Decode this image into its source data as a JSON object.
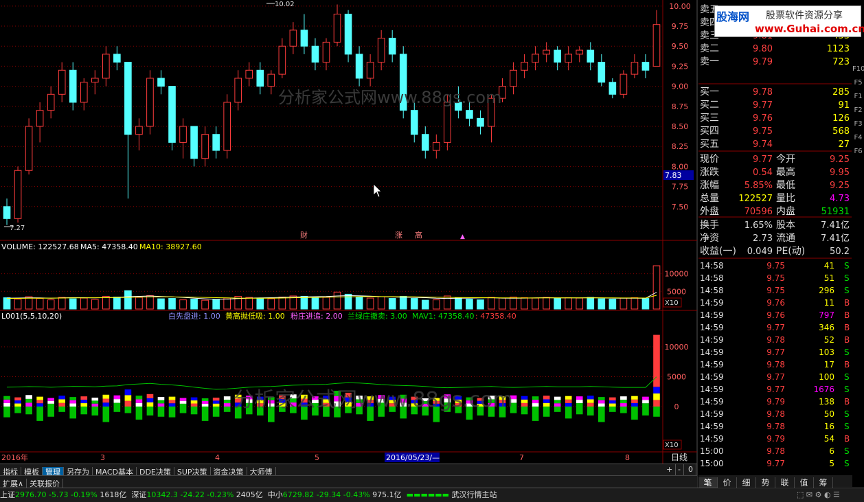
{
  "price_chart": {
    "y_ticks": [
      "10.00",
      "9.75",
      "9.50",
      "9.25",
      "9.00",
      "8.75",
      "8.50",
      "8.25",
      "8.00",
      "7.75",
      "7.50"
    ],
    "high_label": "10.02",
    "low_label": "7.27",
    "current_tag": "7.83",
    "watermark": "分析家公式网www.88gs.com",
    "markers": [
      "财",
      "涨",
      "高"
    ],
    "ylim": [
      7.25,
      10.05
    ]
  },
  "volume_panel": {
    "header_volume_label": "VOLUME: 122527.68",
    "header_ma5_label": "MA5: 47358.40",
    "header_ma10_label": "MA10: 38927.60",
    "y_ticks": [
      "10000",
      "5000"
    ],
    "scale_tag": "X10"
  },
  "indicator_panel": {
    "name": "L001(5,5,10,20)",
    "legend_white": "白先盘进: 1.00",
    "legend_yellow": "黄高抛低吸: 1.00",
    "legend_pink": "粉庄进追: 2.00",
    "legend_green": "兰绿庄撤卖: 3.00",
    "legend_mav": "MAV1: 47358.40",
    "legend_mav2": ": 47358.40",
    "y_ticks": [
      "10000",
      "5000",
      "0"
    ],
    "scale_tag": "X10",
    "watermark": "分析家公式网www.88gs.com"
  },
  "date_axis": {
    "labels": [
      "2016年",
      "3",
      "4",
      "5",
      "2016/05/23/—",
      "7",
      "8"
    ],
    "period": "日线"
  },
  "toolbar": {
    "tabs": [
      "指标",
      "模板",
      "管理",
      "另存为",
      "MACD基本",
      "DDE决策",
      "SUP决策",
      "资金决策",
      "大师傅"
    ],
    "tabs2": [
      "扩展∧",
      "关联报价"
    ],
    "controls": [
      "+",
      "-",
      "0"
    ]
  },
  "logo": {
    "name": "股海网",
    "slogan": "股票软件资源分享",
    "url": "www.Guhai.com.cn"
  },
  "order_book": {
    "sell": [
      {
        "label": "卖五",
        "price": "",
        "vol": ""
      },
      {
        "label": "卖四",
        "price": "",
        "vol": ""
      },
      {
        "label": "卖三",
        "price": "9.81",
        "vol": "433"
      },
      {
        "label": "卖二",
        "price": "9.80",
        "vol": "1123"
      },
      {
        "label": "卖一",
        "price": "9.79",
        "vol": "723"
      }
    ],
    "buy": [
      {
        "label": "买一",
        "price": "9.78",
        "vol": "285"
      },
      {
        "label": "买二",
        "price": "9.77",
        "vol": "91"
      },
      {
        "label": "买三",
        "price": "9.76",
        "vol": "126"
      },
      {
        "label": "买四",
        "price": "9.75",
        "vol": "568"
      },
      {
        "label": "买五",
        "price": "9.74",
        "vol": "27"
      }
    ]
  },
  "quote": {
    "rows": [
      {
        "l1": "现价",
        "v1": "9.77",
        "l2": "今开",
        "v2": "9.25"
      },
      {
        "l1": "涨跌",
        "v1": "0.54",
        "l2": "最高",
        "v2": "9.95"
      },
      {
        "l1": "涨幅",
        "v1": "5.85%",
        "l2": "最低",
        "v2": "9.25"
      },
      {
        "l1": "总量",
        "v1": "122527",
        "l2": "量比",
        "v2": "4.73"
      },
      {
        "l1": "外盘",
        "v1": "70596",
        "l2": "内盘",
        "v2": "51931"
      }
    ],
    "rows2": [
      {
        "l1": "换手",
        "v1": "1.65%",
        "l2": "股本",
        "v2": "7.41亿"
      },
      {
        "l1": "净资",
        "v1": "2.73",
        "l2": "流通",
        "v2": "7.41亿"
      },
      {
        "l1": "收益(一)",
        "v1": "0.049",
        "l2": "PE(动)",
        "v2": "50.2"
      }
    ]
  },
  "trades": [
    {
      "t": "14:58",
      "p": "9.75",
      "v": "41",
      "s": "S"
    },
    {
      "t": "14:58",
      "p": "9.75",
      "v": "51",
      "s": "S"
    },
    {
      "t": "14:58",
      "p": "9.75",
      "v": "296",
      "s": "S"
    },
    {
      "t": "14:59",
      "p": "9.76",
      "v": "11",
      "s": "B"
    },
    {
      "t": "14:59",
      "p": "9.76",
      "v": "797",
      "s": "B"
    },
    {
      "t": "14:59",
      "p": "9.77",
      "v": "346",
      "s": "B"
    },
    {
      "t": "14:59",
      "p": "9.78",
      "v": "52",
      "s": "B"
    },
    {
      "t": "14:59",
      "p": "9.77",
      "v": "103",
      "s": "S"
    },
    {
      "t": "14:59",
      "p": "9.78",
      "v": "17",
      "s": "B"
    },
    {
      "t": "14:59",
      "p": "9.77",
      "v": "100",
      "s": "S"
    },
    {
      "t": "14:59",
      "p": "9.77",
      "v": "1676",
      "s": "S"
    },
    {
      "t": "14:59",
      "p": "9.79",
      "v": "138",
      "s": "B"
    },
    {
      "t": "14:59",
      "p": "9.78",
      "v": "50",
      "s": "S"
    },
    {
      "t": "14:59",
      "p": "9.78",
      "v": "16",
      "s": "S"
    },
    {
      "t": "14:59",
      "p": "9.79",
      "v": "54",
      "s": "B"
    },
    {
      "t": "15:00",
      "p": "9.78",
      "v": "6",
      "s": "S"
    },
    {
      "t": "15:00",
      "p": "9.77",
      "v": "5",
      "s": "S"
    }
  ],
  "right_tabs": [
    "笔",
    "价",
    "细",
    "势",
    "联",
    "值",
    "筹"
  ],
  "side_tabs": [
    "F10",
    "F5",
    "F1",
    "F2",
    "F3",
    "F4",
    "F6"
  ],
  "statusbar": {
    "idx1_name": "上证",
    "idx1_val": "2976.70",
    "idx1_chg": "-5.73",
    "idx1_pct": "-0.19%",
    "idx1_amt": "1618亿",
    "idx2_name": "深证",
    "idx2_val": "10342.3",
    "idx2_chg": "-24.22",
    "idx2_pct": "-0.23%",
    "idx2_amt": "2405亿",
    "idx3_name": "中小",
    "idx3_val": "6729.82",
    "idx3_chg": "-29.34",
    "idx3_pct": "-0.43%",
    "idx3_amt": "975.1亿",
    "server": "武汉行情主站"
  },
  "colors": {
    "up": "#ff3c3c",
    "down": "#54ffff",
    "grid": "#8b0000",
    "yellow": "#ffff00",
    "magenta": "#ff00ff",
    "green": "#00d000"
  },
  "chart_data": {
    "type": "candlestick",
    "ohlc": [
      [
        7.5,
        7.6,
        7.27,
        7.35
      ],
      [
        7.35,
        8.0,
        7.3,
        7.95
      ],
      [
        7.95,
        8.6,
        7.9,
        8.5
      ],
      [
        8.5,
        8.8,
        8.3,
        8.7
      ],
      [
        8.7,
        9.0,
        8.6,
        8.9
      ],
      [
        8.9,
        9.3,
        8.8,
        9.2
      ],
      [
        9.2,
        9.3,
        8.7,
        8.8
      ],
      [
        8.8,
        9.1,
        8.7,
        9.05
      ],
      [
        9.05,
        9.2,
        8.9,
        9.1
      ],
      [
        9.1,
        9.5,
        9.0,
        9.4
      ],
      [
        9.4,
        9.5,
        9.2,
        9.3
      ],
      [
        9.3,
        9.3,
        7.6,
        8.4
      ],
      [
        8.4,
        8.6,
        8.2,
        8.5
      ],
      [
        8.5,
        9.2,
        8.4,
        9.1
      ],
      [
        9.1,
        9.2,
        8.9,
        9.0
      ],
      [
        9.0,
        9.0,
        8.2,
        8.3
      ],
      [
        8.3,
        8.6,
        8.1,
        8.5
      ],
      [
        8.5,
        8.5,
        8.0,
        8.1
      ],
      [
        8.1,
        8.5,
        8.0,
        8.4
      ],
      [
        8.4,
        8.5,
        8.1,
        8.2
      ],
      [
        8.2,
        8.9,
        8.1,
        8.8
      ],
      [
        8.8,
        9.2,
        8.7,
        9.1
      ],
      [
        9.1,
        9.3,
        9.0,
        9.2
      ],
      [
        9.2,
        9.3,
        8.9,
        9.0
      ],
      [
        9.0,
        9.2,
        8.9,
        9.15
      ],
      [
        9.15,
        9.6,
        9.1,
        9.5
      ],
      [
        9.5,
        9.8,
        9.4,
        9.7
      ],
      [
        9.7,
        9.9,
        9.4,
        9.5
      ],
      [
        9.5,
        9.6,
        9.2,
        9.3
      ],
      [
        9.3,
        9.6,
        9.2,
        9.55
      ],
      [
        9.55,
        10.02,
        9.5,
        9.9
      ],
      [
        9.9,
        9.95,
        9.3,
        9.4
      ],
      [
        9.4,
        9.5,
        9.0,
        9.1
      ],
      [
        9.1,
        9.4,
        9.0,
        9.3
      ],
      [
        9.3,
        9.7,
        9.2,
        9.6
      ],
      [
        9.6,
        9.7,
        9.3,
        9.4
      ],
      [
        9.4,
        9.5,
        8.6,
        8.7
      ],
      [
        8.7,
        8.8,
        8.3,
        8.4
      ],
      [
        8.4,
        8.5,
        8.1,
        8.2
      ],
      [
        8.2,
        8.4,
        8.1,
        8.3
      ],
      [
        8.3,
        8.9,
        8.2,
        8.8
      ],
      [
        8.8,
        9.0,
        8.6,
        8.7
      ],
      [
        8.7,
        8.8,
        8.5,
        8.6
      ],
      [
        8.6,
        8.7,
        8.4,
        8.5
      ],
      [
        8.5,
        8.9,
        8.3,
        8.85
      ],
      [
        8.85,
        9.1,
        8.8,
        9.0
      ],
      [
        9.0,
        9.3,
        8.9,
        9.2
      ],
      [
        9.2,
        9.4,
        9.1,
        9.3
      ],
      [
        9.3,
        9.5,
        9.2,
        9.4
      ],
      [
        9.4,
        9.55,
        9.3,
        9.45
      ],
      [
        9.45,
        9.5,
        9.2,
        9.3
      ],
      [
        9.3,
        9.5,
        9.2,
        9.4
      ],
      [
        9.4,
        9.5,
        9.3,
        9.45
      ],
      [
        9.45,
        9.55,
        9.2,
        9.3
      ],
      [
        9.3,
        9.4,
        9.0,
        9.05
      ],
      [
        9.05,
        9.1,
        8.85,
        8.9
      ],
      [
        8.9,
        9.2,
        8.85,
        9.15
      ],
      [
        9.15,
        9.4,
        9.1,
        9.3
      ],
      [
        9.3,
        9.4,
        9.1,
        9.2
      ],
      [
        9.25,
        9.95,
        9.25,
        9.77
      ]
    ],
    "volume": [
      3200,
      2800,
      3500,
      3000,
      2600,
      3300,
      2900,
      3100,
      2700,
      3600,
      3400,
      5200,
      3300,
      3800,
      2900,
      3000,
      2600,
      2800,
      2500,
      2700,
      3100,
      3600,
      3300,
      3000,
      2900,
      3400,
      3700,
      3600,
      3100,
      3300,
      4800,
      4200,
      3300,
      3100,
      3500,
      3000,
      3600,
      3000,
      2500,
      2600,
      3700,
      3200,
      2800,
      2600,
      3300,
      3100,
      3400,
      3200,
      3100,
      3300,
      3000,
      3200,
      3100,
      3300,
      2900,
      2800,
      3100,
      3200,
      3000,
      12253
    ],
    "ma5": [
      3100,
      3120,
      3180,
      3150,
      3080,
      3150,
      3220,
      3200,
      3150,
      3250,
      3300,
      3500,
      3600,
      3700,
      3550,
      3450,
      3300,
      3100,
      2900,
      2750,
      2800,
      2950,
      3100,
      3150,
      3200,
      3300,
      3400,
      3450,
      3500,
      3550,
      3700,
      3800,
      3750,
      3650,
      3500,
      3400,
      3350,
      3300,
      3200,
      3050,
      3000,
      3050,
      3100,
      3150,
      3200,
      3100,
      3050,
      3100,
      3150,
      3200,
      3150,
      3150,
      3150,
      3200,
      3150,
      3100,
      3050,
      3050,
      3050,
      4735
    ],
    "ma10": [
      3000,
      3020,
      3050,
      3080,
      3100,
      3120,
      3150,
      3170,
      3190,
      3210,
      3250,
      3300,
      3380,
      3420,
      3450,
      3440,
      3400,
      3350,
      3280,
      3200,
      3150,
      3100,
      3080,
      3060,
      3080,
      3120,
      3180,
      3240,
      3290,
      3340,
      3400,
      3460,
      3500,
      3520,
      3520,
      3500,
      3480,
      3450,
      3400,
      3350,
      3300,
      3250,
      3220,
      3200,
      3180,
      3160,
      3150,
      3140,
      3140,
      3150,
      3150,
      3150,
      3150,
      3160,
      3160,
      3150,
      3140,
      3130,
      3120,
      3892
    ],
    "ylim": [
      7.25,
      10.05
    ]
  }
}
